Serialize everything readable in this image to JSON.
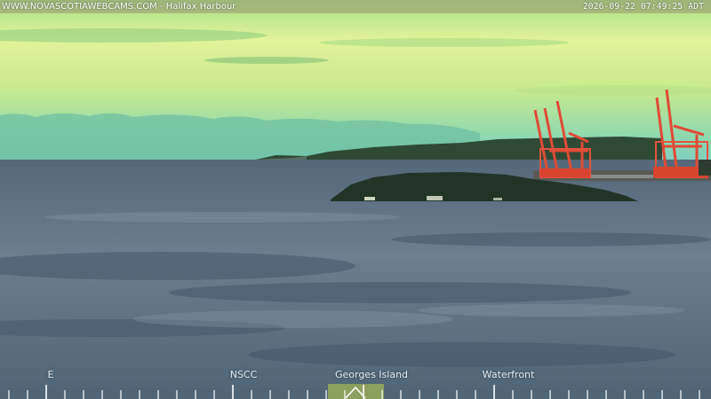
{
  "header": {
    "site": "WWW.NOVASCOTIAWEBCAMS.COM - Halifax Harbour",
    "timestamp": "2026-09-22 07:49:25 ADT"
  },
  "compass": {
    "labels": [
      {
        "text": "E"
      },
      {
        "text": "NSCC"
      },
      {
        "text": "Georges Island"
      },
      {
        "text": "Waterfront"
      }
    ],
    "pointer_icon": "view-direction-pointer-icon"
  },
  "colors": {
    "sky": "#c9e79a",
    "water": "#5c6f80",
    "land": "#263a2a",
    "crane": "#d8442f",
    "pointer": "#96aa5a"
  }
}
